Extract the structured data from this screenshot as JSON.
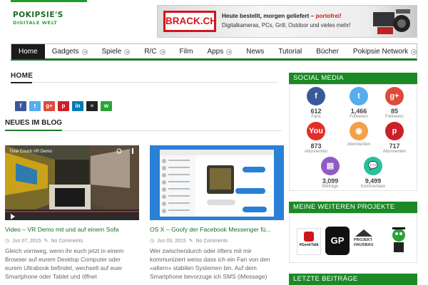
{
  "logo": {
    "line1": "POKIPSIE'S",
    "line2": "DIGITALE WELT"
  },
  "banner": {
    "brand": "BRACK.CH",
    "headline_a": "Heute bestellt, morgen geliefert – ",
    "headline_b": "portofrei!",
    "sub": "Digitalkameras, PCs, Grill, Outdoor und vieles mehr!"
  },
  "nav": [
    {
      "label": "Home",
      "active": true,
      "dropdown": false
    },
    {
      "label": "Gadgets",
      "dropdown": true
    },
    {
      "label": "Spiele",
      "dropdown": true
    },
    {
      "label": "R/C",
      "dropdown": true
    },
    {
      "label": "Film",
      "dropdown": false
    },
    {
      "label": "Apps",
      "dropdown": true
    },
    {
      "label": "News",
      "dropdown": false
    },
    {
      "label": "Tutorial",
      "dropdown": false
    },
    {
      "label": "Bücher",
      "dropdown": false
    },
    {
      "label": "Pokipsie Network",
      "dropdown": true
    }
  ],
  "breadcrumb": "HOME",
  "share_buttons": [
    {
      "name": "facebook",
      "glyph": "f",
      "color": "#3b5998"
    },
    {
      "name": "twitter",
      "glyph": "t",
      "color": "#55acee"
    },
    {
      "name": "google-plus",
      "glyph": "g+",
      "color": "#dd4b39"
    },
    {
      "name": "pinterest",
      "glyph": "p",
      "color": "#cb2027"
    },
    {
      "name": "linkedin",
      "glyph": "in",
      "color": "#007bb5"
    },
    {
      "name": "buffer",
      "glyph": "≡",
      "color": "#222222"
    },
    {
      "name": "whatsapp",
      "glyph": "w",
      "color": "#2aa335"
    }
  ],
  "section_title": "NEUES IM BLOG",
  "posts": [
    {
      "title": "Video – VR Demo mit und auf einem Sofa",
      "date": "Jun 07, 2015",
      "comments": "No Comments",
      "excerpt": "Gleich vornweg, wenn ihr euch jetzt in einem Browser auf eurem Desktop Computer oder eurem Ultrabook befindet, wechselt auf euer Smartphone oder Tablet und öffnet",
      "video_title": "Time Couch VR Demo"
    },
    {
      "title": "OS X – Goofy der Facebook Messenger fü...",
      "date": "Jun 03, 2015",
      "comments": "No Comments",
      "excerpt": "Wer zwischendurch oder öfters mit mir kommuniziert weiss dass ich ein Fan von den «altern» stabilen Systemen bin. Auf dem Smartphone bevorzuge ich SMS (iMessage)"
    }
  ],
  "sidebar": {
    "social_title": "SOCIAL MEDIA",
    "social": [
      {
        "icon": "facebook-icon",
        "glyph": "f",
        "color": "#3b5998",
        "count": "612",
        "label": "Fans"
      },
      {
        "icon": "twitter-icon",
        "glyph": "t",
        "color": "#55acee",
        "count": "1,466",
        "label": "Followers"
      },
      {
        "icon": "google-plus-icon",
        "glyph": "g+",
        "color": "#dd4b39",
        "count": "85",
        "label": "Followers"
      },
      {
        "icon": "youtube-icon",
        "glyph": "You",
        "color": "#e52d27",
        "count": "873",
        "label": "Abonnenten"
      },
      {
        "icon": "rss-icon",
        "glyph": "◉",
        "color": "#f3a04a",
        "count": "",
        "label": "Abonnenten"
      },
      {
        "icon": "pinterest-icon",
        "glyph": "p",
        "color": "#cb2027",
        "count": "717",
        "label": "Abonnenten"
      },
      {
        "icon": "posts-icon",
        "glyph": "▤",
        "color": "#8f5bc5",
        "count": "3,099",
        "label": "Beiträge"
      },
      {
        "icon": "comments-icon",
        "glyph": "💬",
        "color": "#2bbf9c",
        "count": "9,499",
        "label": "Kommentare"
      }
    ],
    "projects_title": "MEINE WEITEREN PROJEKTE",
    "projects": [
      {
        "name": "geektalk",
        "text": "#GeekTalk"
      },
      {
        "name": "gp",
        "text": "GP"
      },
      {
        "name": "projekt-hausbau",
        "text": "PROJEKT HAUSBAU"
      },
      {
        "name": "mascot",
        "text": ""
      }
    ],
    "latest_title": "LETZTE BEITRÄGE"
  }
}
